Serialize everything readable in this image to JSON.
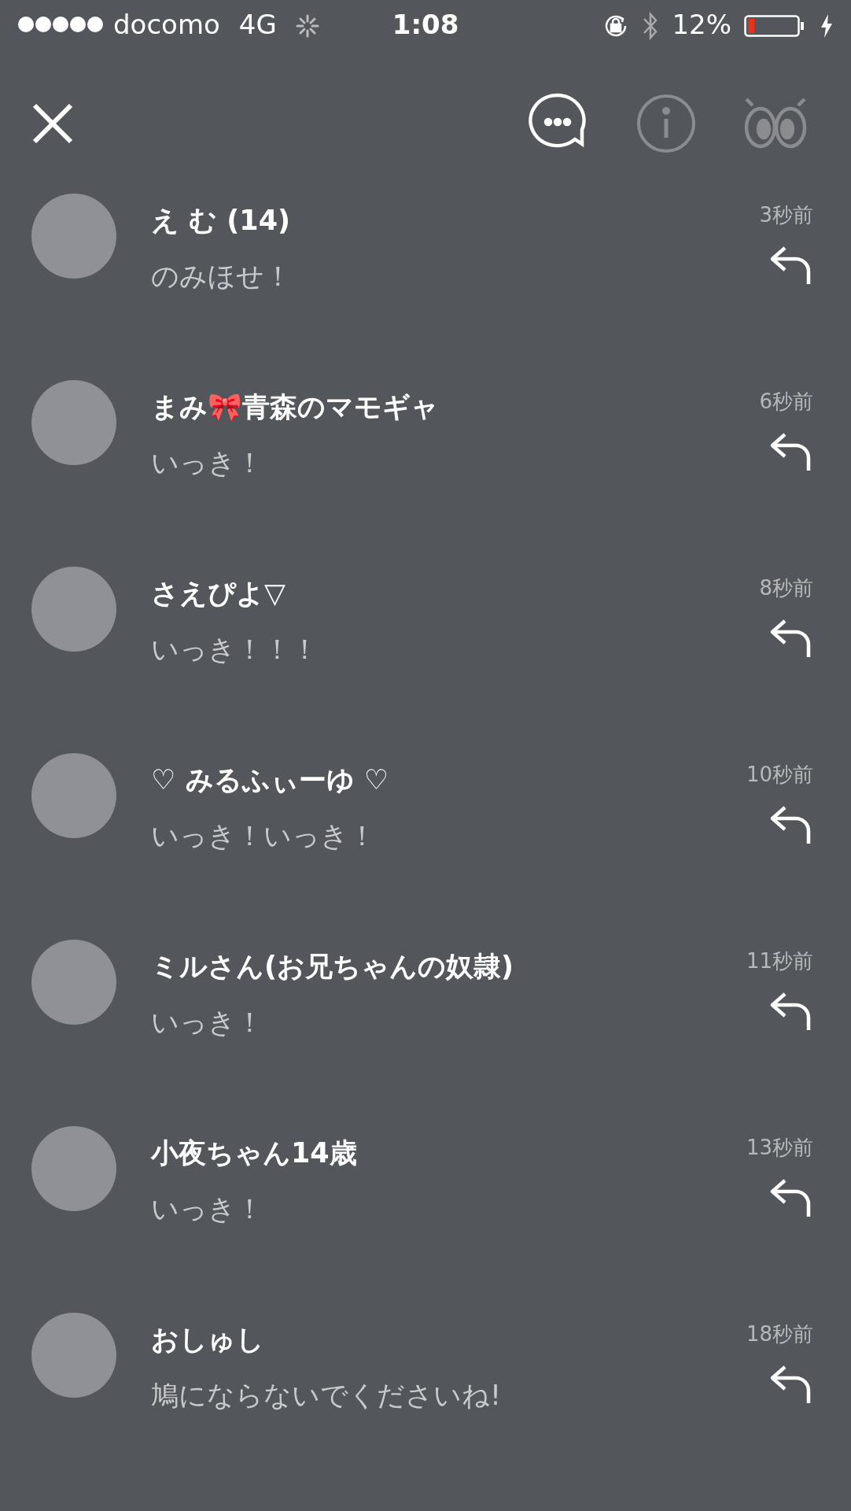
{
  "status_bar": {
    "carrier": "docomo",
    "network": "4G",
    "time": "1:08",
    "battery": "12%"
  },
  "header": {
    "buttons": [
      {
        "kind": "comments",
        "enabled": true
      },
      {
        "kind": "info",
        "enabled": false
      },
      {
        "kind": "eyes",
        "enabled": false
      }
    ]
  },
  "comments": [
    {
      "name": "え む (14)",
      "time": "3秒前",
      "message": "のみほせ！"
    },
    {
      "name": "まみ🎀青森のマモギャ",
      "time": "6秒前",
      "message": "いっき！"
    },
    {
      "name": "さえぴよ▽",
      "time": "8秒前",
      "message": "いっき！！！"
    },
    {
      "name": "♡ みるふぃーゆ ♡",
      "time": "10秒前",
      "message": "いっき！いっき！"
    },
    {
      "name": "ミルさん(お兄ちゃんの奴隷)",
      "time": "11秒前",
      "message": "いっき！"
    },
    {
      "name": "小夜ちゃん14歳",
      "time": "13秒前",
      "message": "いっき！"
    },
    {
      "name": "おしゅし",
      "time": "18秒前",
      "message": "鳩にならないでくださいね!"
    }
  ]
}
